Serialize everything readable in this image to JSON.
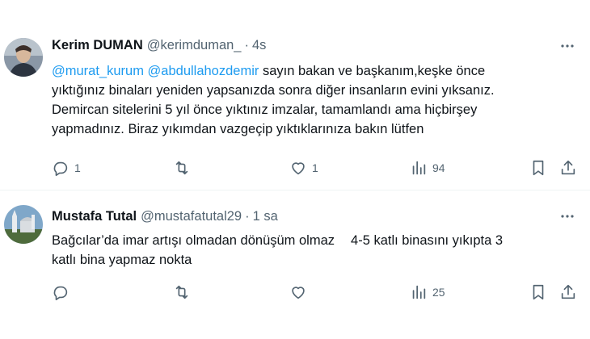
{
  "tweets": [
    {
      "name": "Kerim DUMAN",
      "handle": "@kerimduman_",
      "separator": "·",
      "time": "4s",
      "mention1": "@murat_kurum",
      "mention2": "@abdullahozdemir",
      "line1_text": " sayın bakan ve başkanım,keşke önce",
      "line2": "yıktığınız binaları yeniden yapsanızda sonra diğer insanların evini yıksanız.",
      "line3": "Demircan sitelerini 5 yıl önce yıktınız imzalar, tamamlandı ama hiçbirşey",
      "line4": "yapmadınız. Biraz yıkımdan vazgeçip yıktıklarınıza bakın lütfen",
      "replies": "1",
      "retweets": "",
      "likes": "1",
      "views": "94"
    },
    {
      "name": "Mustafa Tutal",
      "handle": "@mustafatutal29",
      "separator": "·",
      "time": "1 sa",
      "line1a": "Bağcılar’da imar artışı olmadan dönüşüm olmaz",
      "line1b": "4-5 katlı binasını yıkıpta 3",
      "line2": "katlı bina yapmaz nokta",
      "replies": "",
      "retweets": "",
      "likes": "",
      "views": "25"
    }
  ],
  "colors": {
    "text": "#0f1419",
    "secondary": "#536471",
    "link": "#1d9bf0",
    "divider": "#eff3f4"
  },
  "icons": [
    "reply-icon",
    "retweet-icon",
    "like-icon",
    "views-icon",
    "bookmark-icon",
    "share-icon",
    "more-icon"
  ]
}
